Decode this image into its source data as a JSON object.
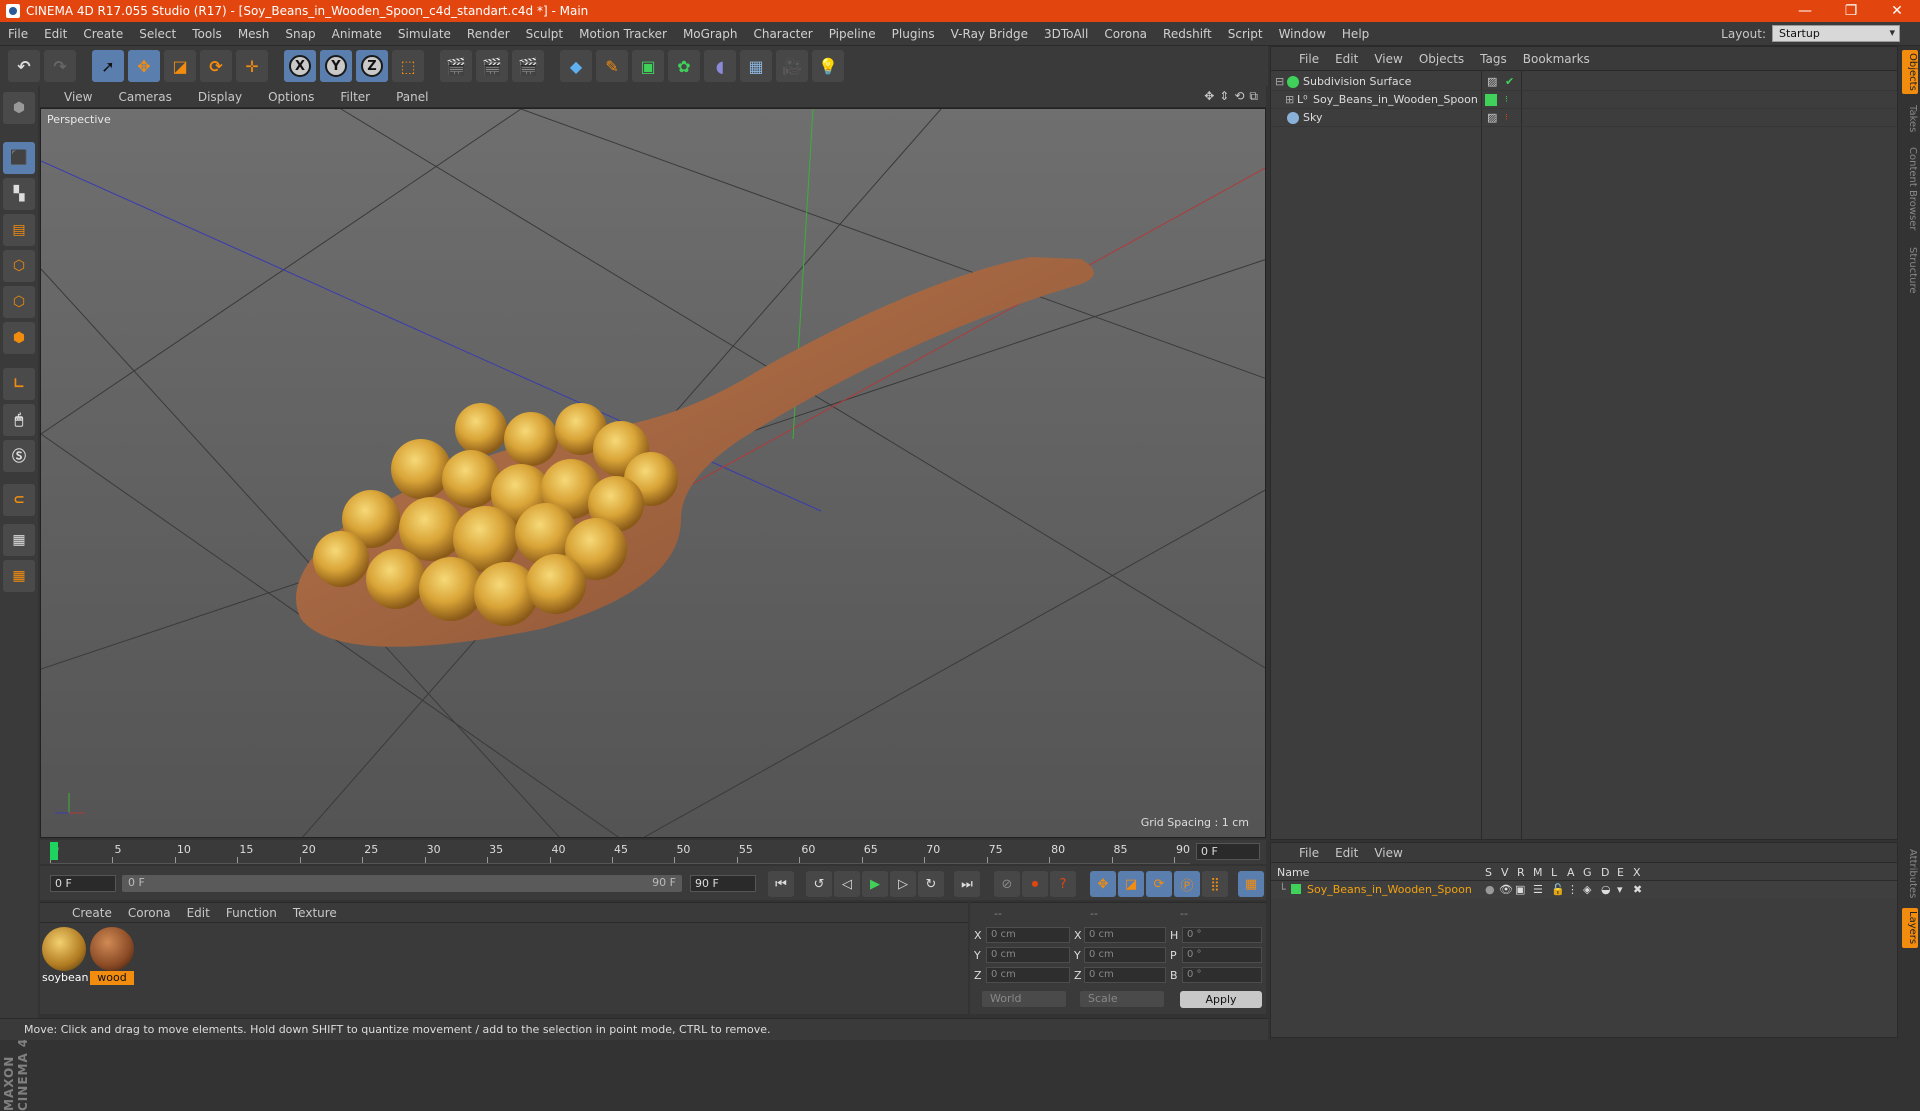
{
  "window": {
    "title": "CINEMA 4D R17.055 Studio (R17) - [Soy_Beans_in_Wooden_Spoon_c4d_standart.c4d *] - Main",
    "minimize": "—",
    "restore": "❐",
    "close": "✕"
  },
  "menu": [
    "File",
    "Edit",
    "Create",
    "Select",
    "Tools",
    "Mesh",
    "Snap",
    "Animate",
    "Simulate",
    "Render",
    "Sculpt",
    "Motion Tracker",
    "MoGraph",
    "Character",
    "Pipeline",
    "Plugins",
    "V-Ray Bridge",
    "3DToAll",
    "Corona",
    "Redshift",
    "Script",
    "Window",
    "Help"
  ],
  "layout": {
    "label": "Layout:",
    "value": "Startup"
  },
  "viewport": {
    "menu": [
      "View",
      "Cameras",
      "Display",
      "Options",
      "Filter",
      "Panel"
    ],
    "camera_label": "Perspective",
    "grid_spacing": "Grid Spacing : 1 cm"
  },
  "timeline": {
    "ticks": [
      "0",
      "5",
      "10",
      "15",
      "20",
      "25",
      "30",
      "35",
      "40",
      "45",
      "50",
      "55",
      "60",
      "65",
      "70",
      "75",
      "80",
      "85",
      "90"
    ],
    "current_frame": "0 F",
    "start_field": "0 F",
    "slider_start": "0 F",
    "slider_end": "90 F",
    "end_field": "90 F"
  },
  "materials": {
    "menu": [
      "Create",
      "Corona",
      "Edit",
      "Function",
      "Texture"
    ],
    "items": [
      {
        "name": "soybean",
        "selected": false
      },
      {
        "name": "wood",
        "selected": true
      }
    ]
  },
  "coordinates": {
    "headers": [
      "--",
      "--",
      "--"
    ],
    "rows": [
      {
        "a": "X",
        "pos": "0 cm",
        "b": "X",
        "size": "0 cm",
        "c": "H",
        "rot": "0 °"
      },
      {
        "a": "Y",
        "pos": "0 cm",
        "b": "Y",
        "size": "0 cm",
        "c": "P",
        "rot": "0 °"
      },
      {
        "a": "Z",
        "pos": "0 cm",
        "b": "Z",
        "size": "0 cm",
        "c": "B",
        "rot": "0 °"
      }
    ],
    "mode1": "World",
    "mode2": "Scale",
    "apply": "Apply"
  },
  "status": "Move: Click and drag to move elements. Hold down SHIFT to quantize movement / add to the selection in point mode, CTRL to remove.",
  "objects": {
    "menu": [
      "File",
      "Edit",
      "View",
      "Objects",
      "Tags",
      "Bookmarks"
    ],
    "items": [
      {
        "name": "Subdivision Surface",
        "color": "#3fd15a"
      },
      {
        "name": "Soy_Beans_in_Wooden_Spoon",
        "color": "#3fd15a"
      },
      {
        "name": "Sky",
        "color": "#8ab2d9"
      }
    ]
  },
  "side_tabs": [
    "Objects",
    "Takes",
    "Content Browser",
    "Structure",
    "Attributes",
    "Layers"
  ],
  "layers": {
    "menu": [
      "File",
      "Edit",
      "View"
    ],
    "columns": [
      "Name",
      "S",
      "V",
      "R",
      "M",
      "L",
      "A",
      "G",
      "D",
      "E",
      "X"
    ],
    "rows": [
      {
        "name": "Soy_Beans_in_Wooden_Spoon",
        "color": "#3fd15a"
      }
    ]
  },
  "brand": "MAXON CINEMA 4D",
  "colors": {
    "accent": "#e3450f",
    "selection": "#f28c0f",
    "active_tool": "#5a7fae"
  }
}
